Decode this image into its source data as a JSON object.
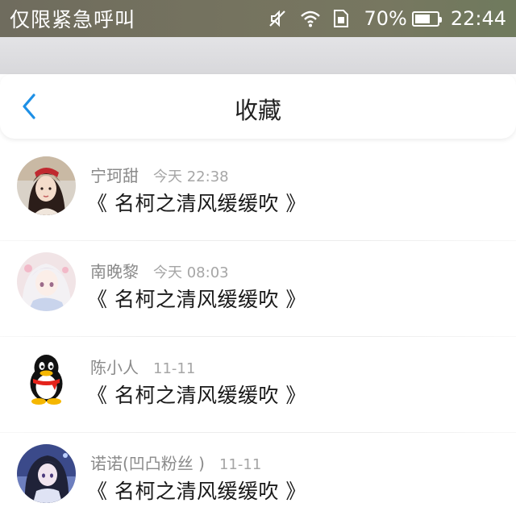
{
  "status_bar": {
    "carrier_text": "仅限紧急呼叫",
    "battery_percent": "70%",
    "battery_level": 0.7,
    "time": "22:44",
    "icons": [
      "mute-icon",
      "wifi-icon",
      "sim-icon",
      "battery-icon"
    ]
  },
  "header": {
    "title": "收藏",
    "back_icon": "chevron-left-icon",
    "accent_color": "#1e90e6"
  },
  "favorites": [
    {
      "username": "宁珂甜",
      "timestamp": "今天 22:38",
      "title": "《 名柯之清风缓缓吹 》",
      "avatar": "photo-avatar"
    },
    {
      "username": "南晚黎",
      "timestamp": "今天 08:03",
      "title": "《 名柯之清风缓缓吹 》",
      "avatar": "anime-avatar"
    },
    {
      "username": "陈小人",
      "timestamp": "11-11",
      "title": "《 名柯之清风缓缓吹 》",
      "avatar": "qq-penguin-avatar"
    },
    {
      "username": "诺诺(凹凸粉丝 )",
      "timestamp": "11-11",
      "title": "《 名柯之清风缓缓吹 》",
      "avatar": "anime-avatar-dark"
    }
  ]
}
